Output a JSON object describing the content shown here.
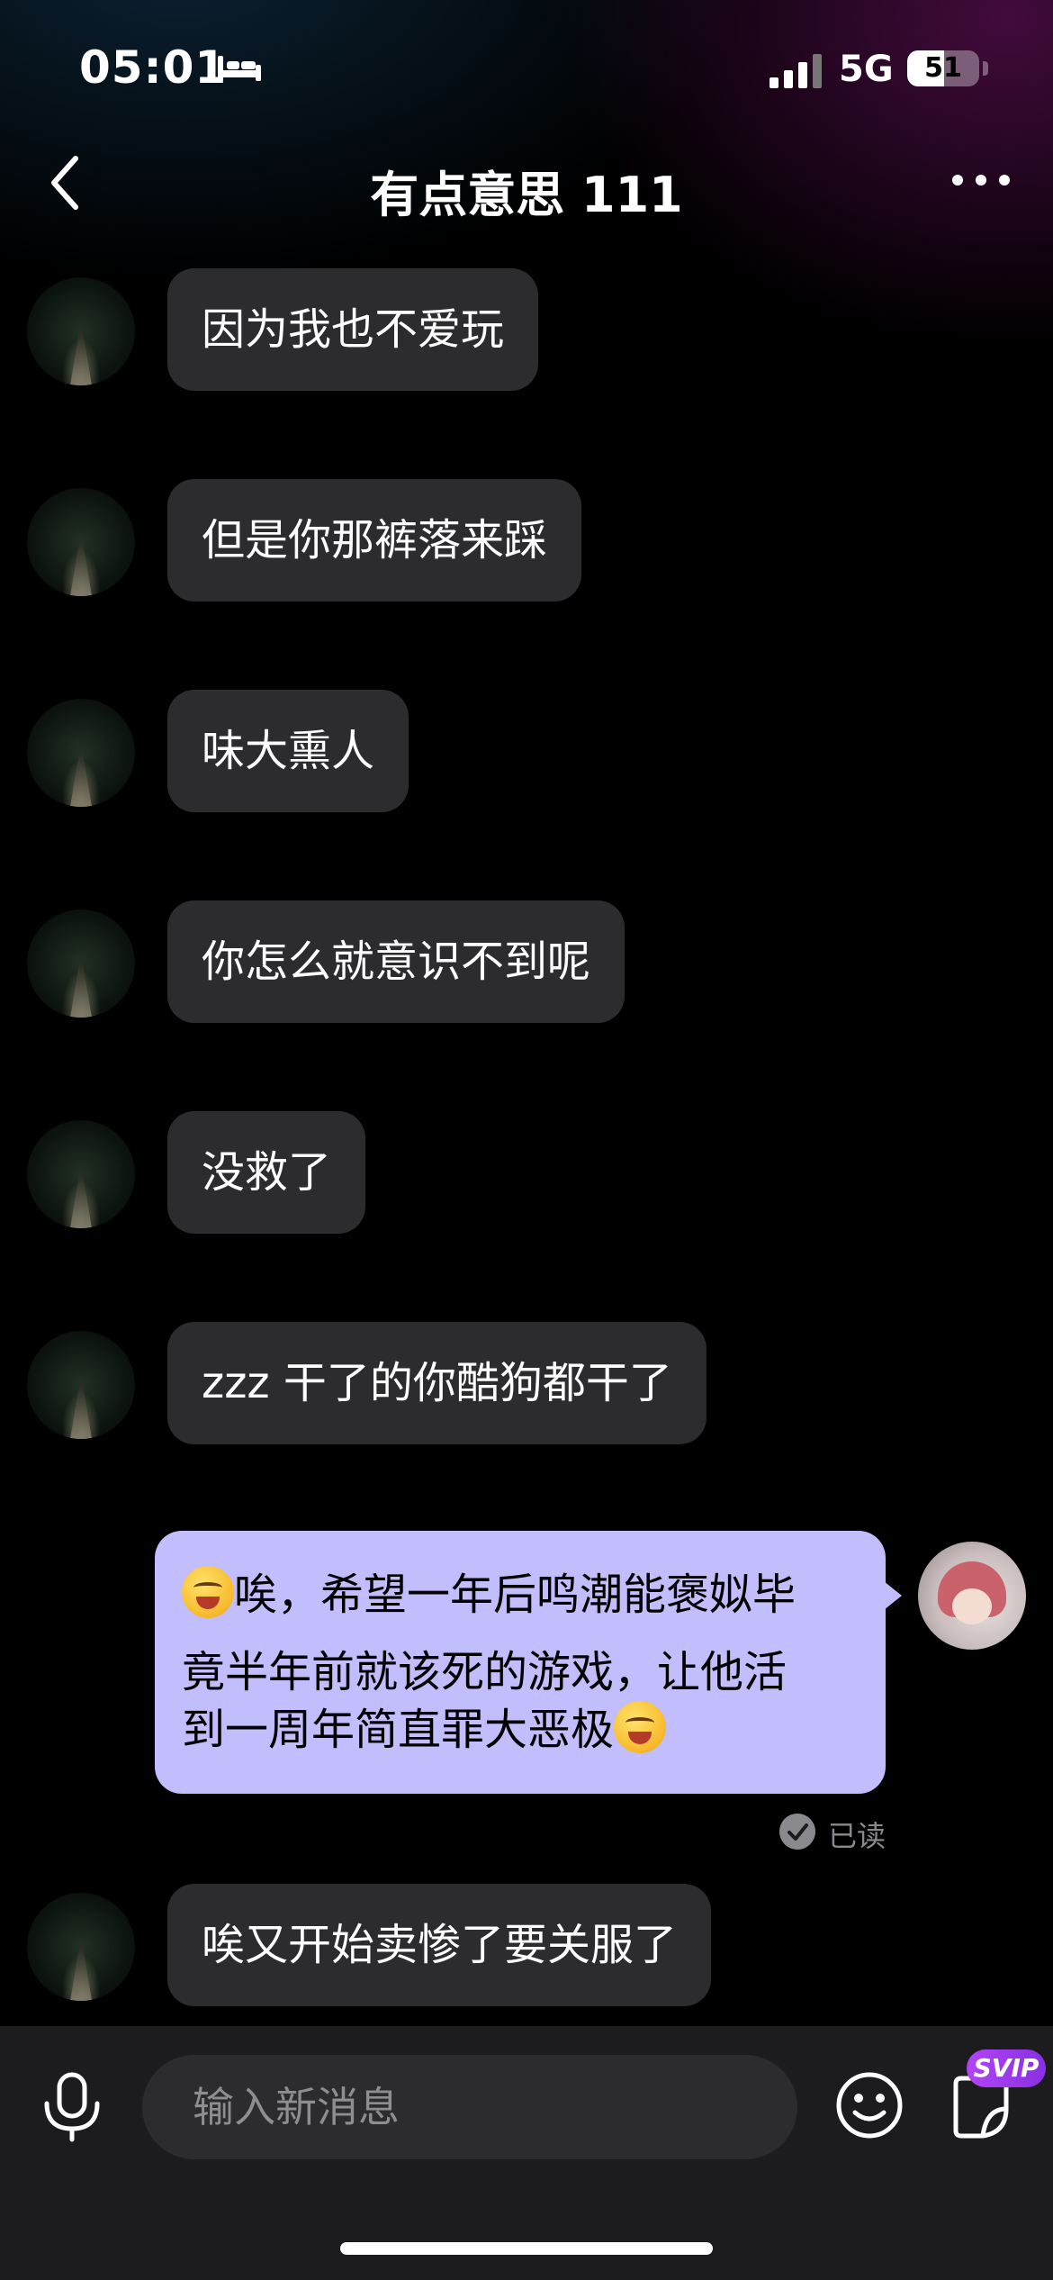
{
  "status_bar": {
    "time": "05:01",
    "network": "5G",
    "battery_text": "51",
    "battery_level_percent": 51,
    "icons": [
      "bed-icon",
      "signal-icon",
      "battery-icon"
    ]
  },
  "header": {
    "title": "有点意思 111",
    "back_icon": "chevron-left-icon",
    "more_icon": "more-horizontal-icon"
  },
  "messages": [
    {
      "from": "other",
      "text": "因为我也不爱玩"
    },
    {
      "from": "other",
      "text": "但是你那裤落来踩"
    },
    {
      "from": "other",
      "text": "味大熏人"
    },
    {
      "from": "other",
      "text": "你怎么就意识不到呢"
    },
    {
      "from": "other",
      "text": "没救了"
    },
    {
      "from": "other",
      "text": "zzz 干了的你酷狗都干了"
    },
    {
      "from": "me",
      "leading_emoji": "yum-emoji",
      "line1": "唉，希望一年后鸣潮能褒姒毕",
      "line2": "竟半年前就该死的游戏，让他活",
      "line3": "到一周年简直罪大恶极",
      "trailing_emoji": "laughing-emoji",
      "status": "已读"
    },
    {
      "from": "other",
      "text": "唉又开始卖惨了要关服了"
    }
  ],
  "input_bar": {
    "placeholder": "输入新消息",
    "svip_badge": "SVIP",
    "icons": [
      "microphone-icon",
      "smiley-icon",
      "sticker-icon"
    ]
  },
  "colors": {
    "outgoing_bubble": "#c2bdfc",
    "incoming_bubble": "#2c2c2e",
    "svip": "#b145f5"
  }
}
